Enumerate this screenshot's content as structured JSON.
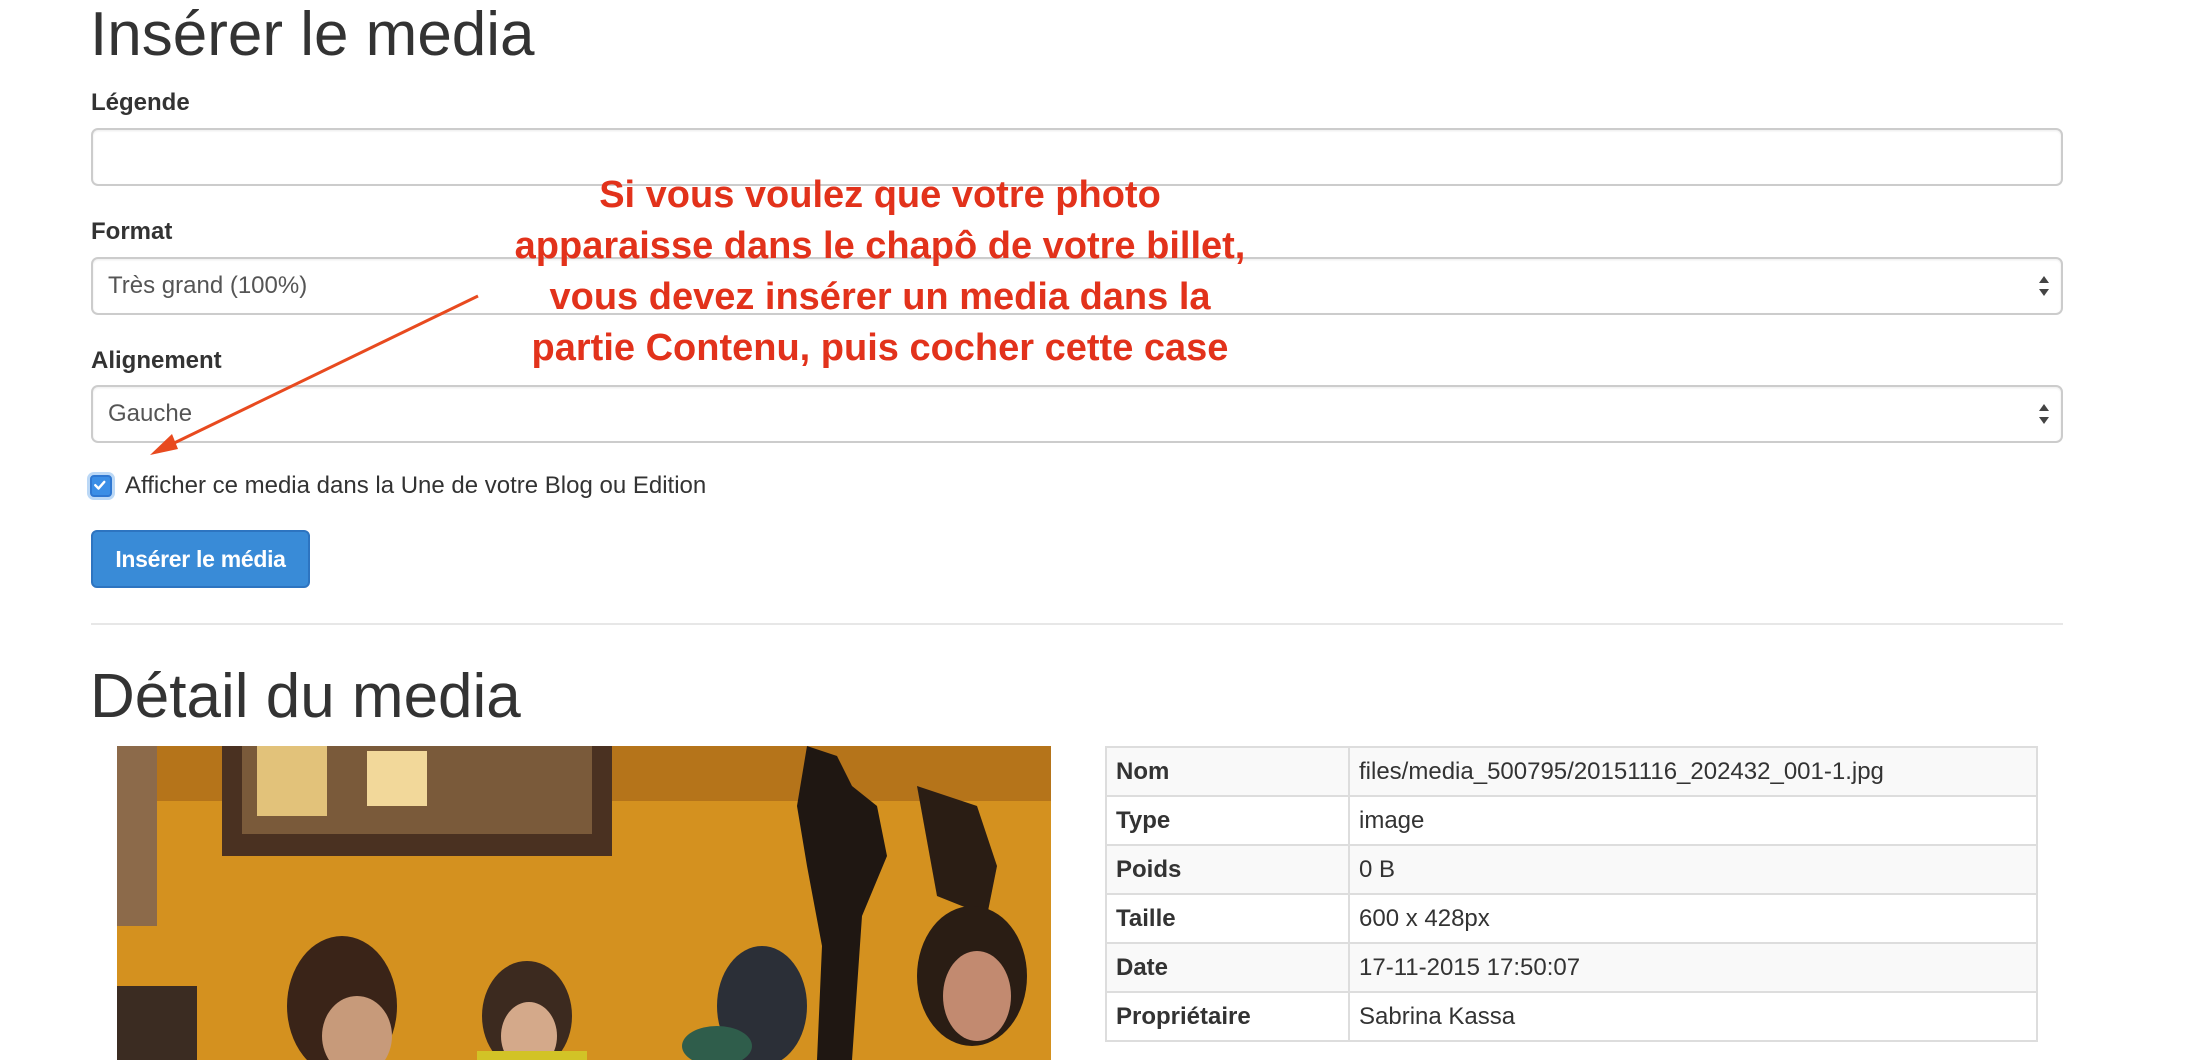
{
  "insert": {
    "title": "Insérer le media",
    "legend_label": "Légende",
    "legend_value": "",
    "format_label": "Format",
    "format_value": "Très grand (100%)",
    "align_label": "Alignement",
    "align_value": "Gauche",
    "checkbox_label": "Afficher ce media dans la Une de votre Blog ou Edition",
    "checkbox_checked": true,
    "submit_label": "Insérer le média"
  },
  "annotation": {
    "text": "Si vous voulez que votre photo apparaisse dans le chapô de votre billet, vous devez insérer un media dans la partie Contenu, puis cocher cette case",
    "color": "#e2321b"
  },
  "detail": {
    "title": "Détail du media",
    "rows": [
      {
        "key": "Nom",
        "value": "files/media_500795/20151116_202432_001-1.jpg"
      },
      {
        "key": "Type",
        "value": "image"
      },
      {
        "key": "Poids",
        "value": "0 B"
      },
      {
        "key": "Taille",
        "value": "600 x 428px"
      },
      {
        "key": "Date",
        "value": "17-11-2015 17:50:07"
      },
      {
        "key": "Propriétaire",
        "value": "Sabrina Kassa"
      }
    ]
  },
  "colors": {
    "primary": "#398bd7",
    "text": "#333333",
    "border": "#cccccc"
  }
}
